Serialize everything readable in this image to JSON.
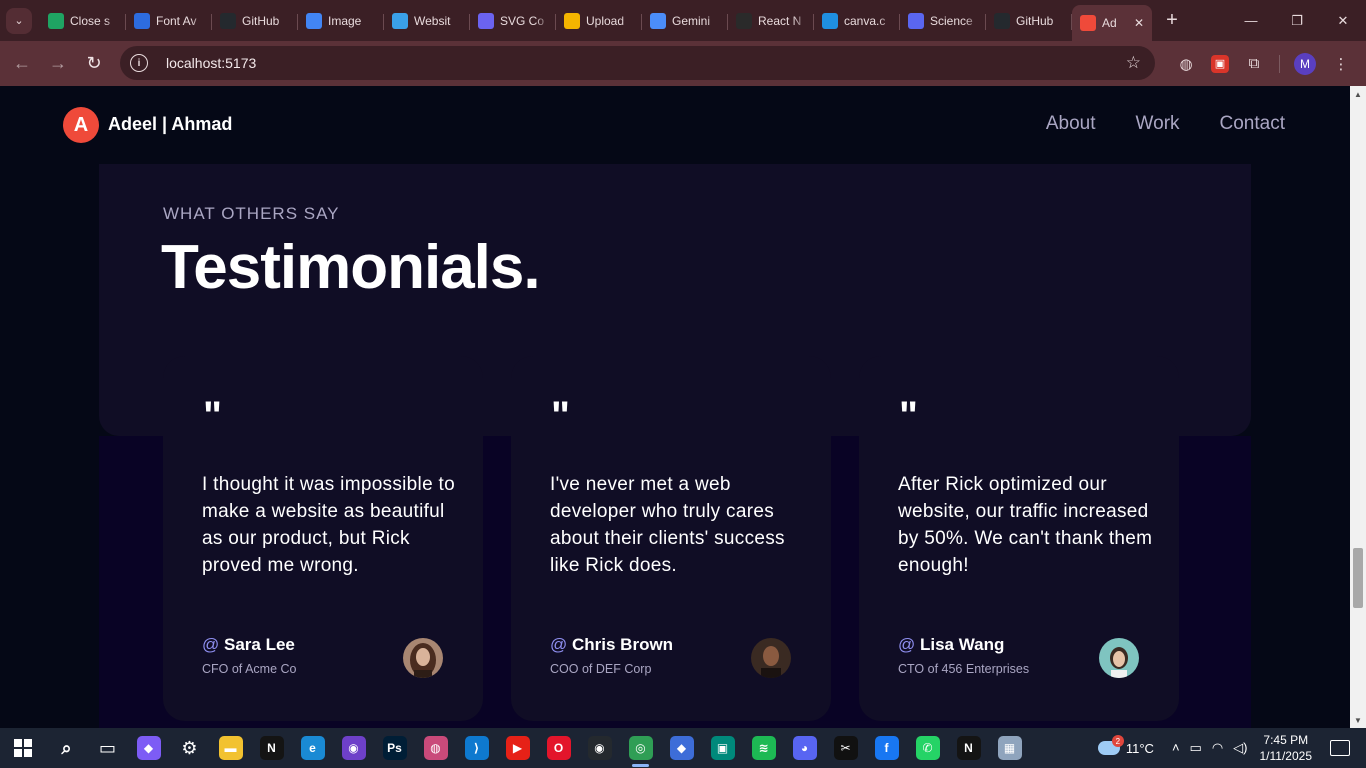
{
  "browser": {
    "tabs": [
      {
        "title": "Close s",
        "icon": "sheets-icon",
        "color": "#1fa463"
      },
      {
        "title": "Font Av",
        "icon": "flag-icon",
        "color": "#2d6cdf"
      },
      {
        "title": "GitHub",
        "icon": "github-icon",
        "color": "#24292e"
      },
      {
        "title": "Image",
        "icon": "image-icon",
        "color": "#4285f4"
      },
      {
        "title": "Websit",
        "icon": "globe-icon",
        "color": "#3aa0e8"
      },
      {
        "title": "SVG Co",
        "icon": "svg-icon",
        "color": "#6b63f0"
      },
      {
        "title": "Upload",
        "icon": "upload-icon",
        "color": "#f4b400"
      },
      {
        "title": "Gemini",
        "icon": "gemini-icon",
        "color": "#4b8df8"
      },
      {
        "title": "React N",
        "icon": "react-icon",
        "color": "#2a2a2a"
      },
      {
        "title": "canva.c",
        "icon": "canva-icon",
        "color": "#1f8fe0"
      },
      {
        "title": "Science",
        "icon": "science-icon",
        "color": "#5a66f0"
      },
      {
        "title": "GitHub",
        "icon": "github-icon",
        "color": "#24292e"
      }
    ],
    "active_tab": {
      "title": "Ad",
      "icon": "site-logo-icon",
      "color": "#ef4a3a"
    },
    "url": "localhost:5173",
    "profile_initial": "M"
  },
  "site": {
    "logo_letter": "A",
    "brand": "Adeel | Ahmad",
    "nav": [
      "About",
      "Work",
      "Contact"
    ]
  },
  "section": {
    "eyebrow": "WHAT OTHERS SAY",
    "heading": "Testimonials."
  },
  "testimonials": [
    {
      "quote_mark": "\"",
      "text": "I thought it was impossible to make a website as beautiful as our product, but Rick proved me wrong.",
      "at": "@",
      "name": "Sara Lee",
      "role": "CFO of Acme Co",
      "avatar_color": "#6b4636"
    },
    {
      "quote_mark": "\"",
      "text": "I've never met a web developer who truly cares about their clients' success like Rick does.",
      "at": "@",
      "name": "Chris Brown",
      "role": "COO of DEF Corp",
      "avatar_color": "#3a2a22"
    },
    {
      "quote_mark": "\"",
      "text": "After Rick optimized our website, our traffic increased by 50%. We can't thank them enough!",
      "at": "@",
      "name": "Lisa Wang",
      "role": "CTO of 456 Enterprises",
      "avatar_color": "#7fc4c0"
    }
  ],
  "taskbar": {
    "weather_temp": "11°C",
    "weather_badge": "2",
    "time": "7:45 PM",
    "date": "1/11/2025",
    "apps": [
      {
        "name": "search-icon",
        "glyph": "⌕",
        "color": "transparent"
      },
      {
        "name": "task-view-icon",
        "glyph": "▭",
        "color": "transparent"
      },
      {
        "name": "copilot-icon",
        "glyph": "◆",
        "color": "#7d5cf5"
      },
      {
        "name": "settings-icon",
        "glyph": "⚙",
        "color": "transparent"
      },
      {
        "name": "file-explorer-icon",
        "glyph": "▬",
        "color": "#f2c230"
      },
      {
        "name": "netflix-icon",
        "glyph": "N",
        "color": "#141414"
      },
      {
        "name": "edge-icon",
        "glyph": "e",
        "color": "#1a8ad4"
      },
      {
        "name": "github-desktop-icon",
        "glyph": "◉",
        "color": "#6e40c9"
      },
      {
        "name": "photoshop-icon",
        "glyph": "Ps",
        "color": "#001e36"
      },
      {
        "name": "app-icon",
        "glyph": "◍",
        "color": "#c94a7a"
      },
      {
        "name": "vscode-icon",
        "glyph": "⟩",
        "color": "#0e79cf"
      },
      {
        "name": "youtube-icon",
        "glyph": "▶",
        "color": "#e62117"
      },
      {
        "name": "opera-icon",
        "glyph": "O",
        "color": "#e3152b"
      },
      {
        "name": "github-icon",
        "glyph": "◉",
        "color": "#24292e"
      },
      {
        "name": "chrome-icon",
        "glyph": "◎",
        "color": "#2f9e55"
      },
      {
        "name": "app-icon-2",
        "glyph": "◆",
        "color": "#3d6dd8"
      },
      {
        "name": "meet-icon",
        "glyph": "▣",
        "color": "#00897b"
      },
      {
        "name": "spotify-icon",
        "glyph": "≋",
        "color": "#1db954"
      },
      {
        "name": "discord-icon",
        "glyph": "◕",
        "color": "#5865f2"
      },
      {
        "name": "capcut-icon",
        "glyph": "✂",
        "color": "#111111"
      },
      {
        "name": "facebook-icon",
        "glyph": "f",
        "color": "#1877f2"
      },
      {
        "name": "whatsapp-icon",
        "glyph": "✆",
        "color": "#25d366"
      },
      {
        "name": "netflix-icon-2",
        "glyph": "N",
        "color": "#141414"
      },
      {
        "name": "app-icon-3",
        "glyph": "▦",
        "color": "#8fa4bd"
      }
    ]
  }
}
